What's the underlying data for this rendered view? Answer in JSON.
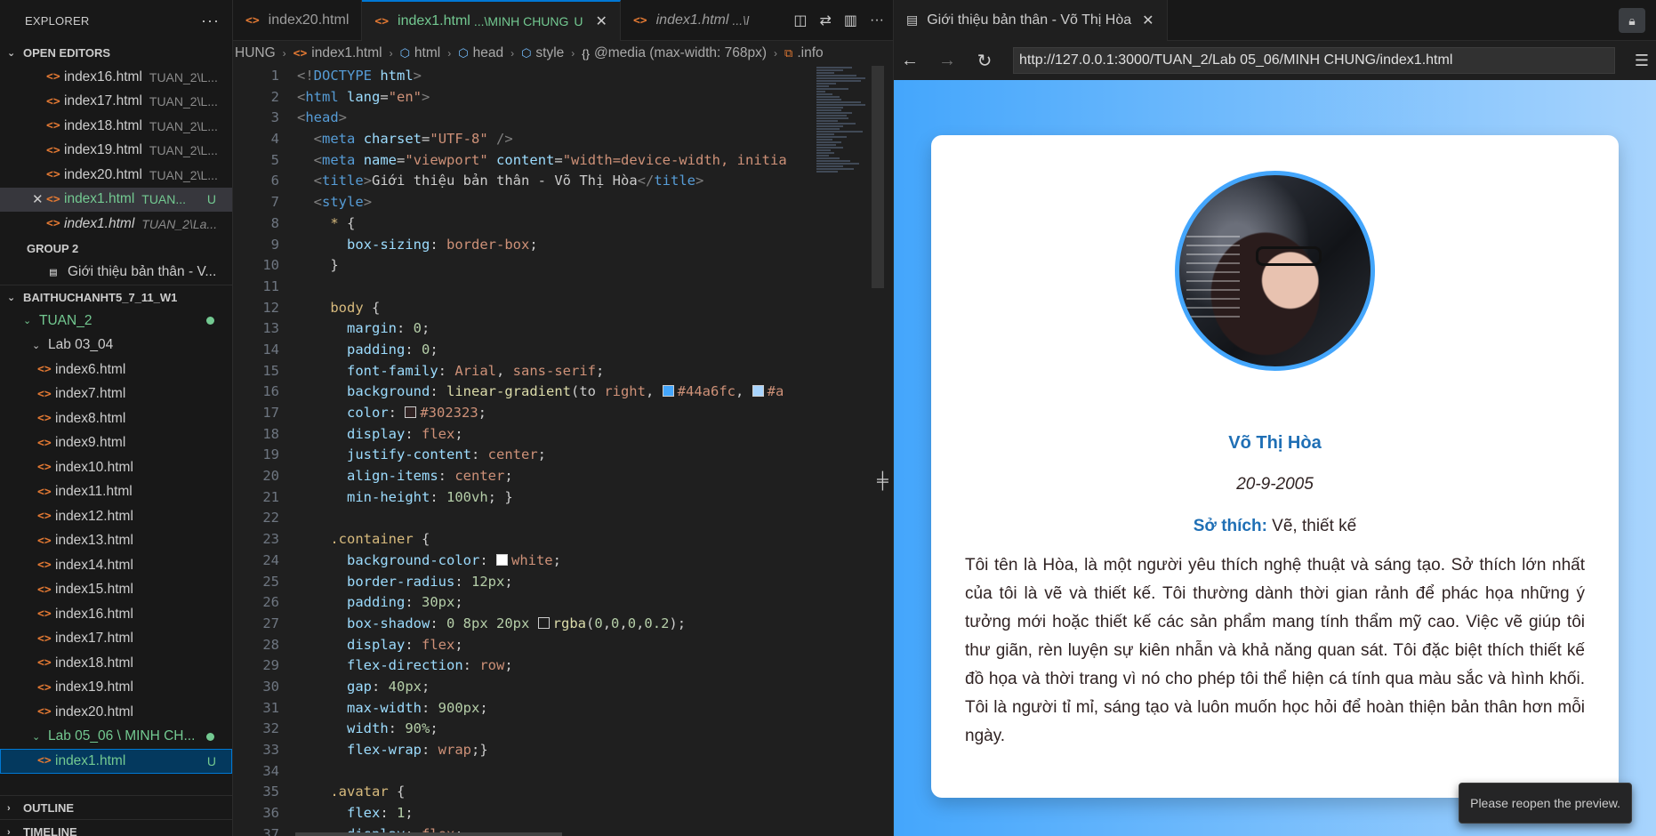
{
  "explorer": {
    "title": "EXPLORER",
    "open_editors_label": "OPEN EDITORS",
    "open_editors": [
      {
        "name": "index16.html",
        "desc": "TUAN_2\\L..."
      },
      {
        "name": "index17.html",
        "desc": "TUAN_2\\L..."
      },
      {
        "name": "index18.html",
        "desc": "TUAN_2\\L..."
      },
      {
        "name": "index19.html",
        "desc": "TUAN_2\\L..."
      },
      {
        "name": "index20.html",
        "desc": "TUAN_2\\L..."
      },
      {
        "name": "index1.html",
        "desc": "TUAN...",
        "badge": "U"
      },
      {
        "name": "index1.html",
        "desc": "TUAN_2\\La..."
      }
    ],
    "group2_label": "GROUP 2",
    "group2_item": "Giới thiệu bản thân - V...",
    "workspace_label": "BAITHUCHANHT5_7_11_W1",
    "folder_tuan2": "TUAN_2",
    "folder_lab0304": "Lab 03_04",
    "lab0304_files": [
      "index6.html",
      "index7.html",
      "index8.html",
      "index9.html",
      "index10.html",
      "index11.html",
      "index12.html",
      "index13.html",
      "index14.html",
      "index15.html",
      "index16.html",
      "index17.html",
      "index18.html",
      "index19.html",
      "index20.html"
    ],
    "folder_lab0506": "Lab 05_06 \\ MINH CH...",
    "selected_file": "index1.html",
    "selected_badge": "U",
    "outline_label": "OUTLINE",
    "timeline_label": "TIMELINE"
  },
  "editor": {
    "tabs": [
      {
        "name": "index20.html",
        "sub": ""
      },
      {
        "name": "index1.html",
        "sub": "...\\MINH CHUNG",
        "badge": "U"
      },
      {
        "name": "index1.html",
        "sub": "...\\l"
      }
    ],
    "breadcrumb": [
      "HUNG",
      "index1.html",
      "html",
      "head",
      "style",
      "@media (max-width: 768px)",
      ".info"
    ],
    "line_numbers": [
      "1",
      "2",
      "3",
      "4",
      "5",
      "6",
      "7",
      "8",
      "9",
      "10",
      "11",
      "12",
      "13",
      "14",
      "15",
      "16",
      "17",
      "18",
      "19",
      "20",
      "21",
      "22",
      "23",
      "24",
      "25",
      "26",
      "27",
      "28",
      "29",
      "30",
      "31",
      "32",
      "33",
      "34",
      "35",
      "36",
      "37"
    ]
  },
  "preview": {
    "tab_title": "Giới thiệu bản thân - Võ Thị Hòa",
    "url": "http://127.0.0.1:3000/TUAN_2/Lab 05_06/MINH CHUNG/index1.html",
    "name": "Võ Thị Hòa",
    "dob": "20-9-2005",
    "hobby_label": "Sở thích:",
    "hobby_value": " Vẽ, thiết kế",
    "bio": "Tôi tên là Hòa, là một người yêu thích nghệ thuật và sáng tạo. Sở thích lớn nhất của tôi là vẽ và thiết kế. Tôi thường dành thời gian rảnh để phác họa những ý tưởng mới hoặc thiết kế các sản phẩm mang tính thẩm mỹ cao. Việc vẽ giúp tôi thư giãn, rèn luyện sự kiên nhẫn và khả năng quan sát. Tôi đặc biệt thích thiết kế đồ họa và thời trang vì nó cho phép tôi thể hiện cá tính qua màu sắc và hình khối. Tôi là người tỉ mỉ, sáng tạo và luôn muốn học hỏi để hoàn thiện bản thân hơn mỗi ngày.",
    "toast": "Please reopen the preview."
  },
  "colors": {
    "accent": "#0078d4",
    "untracked": "#73c991",
    "gradient_start": "#44a6fc",
    "name_color": "#1f6fb5"
  }
}
